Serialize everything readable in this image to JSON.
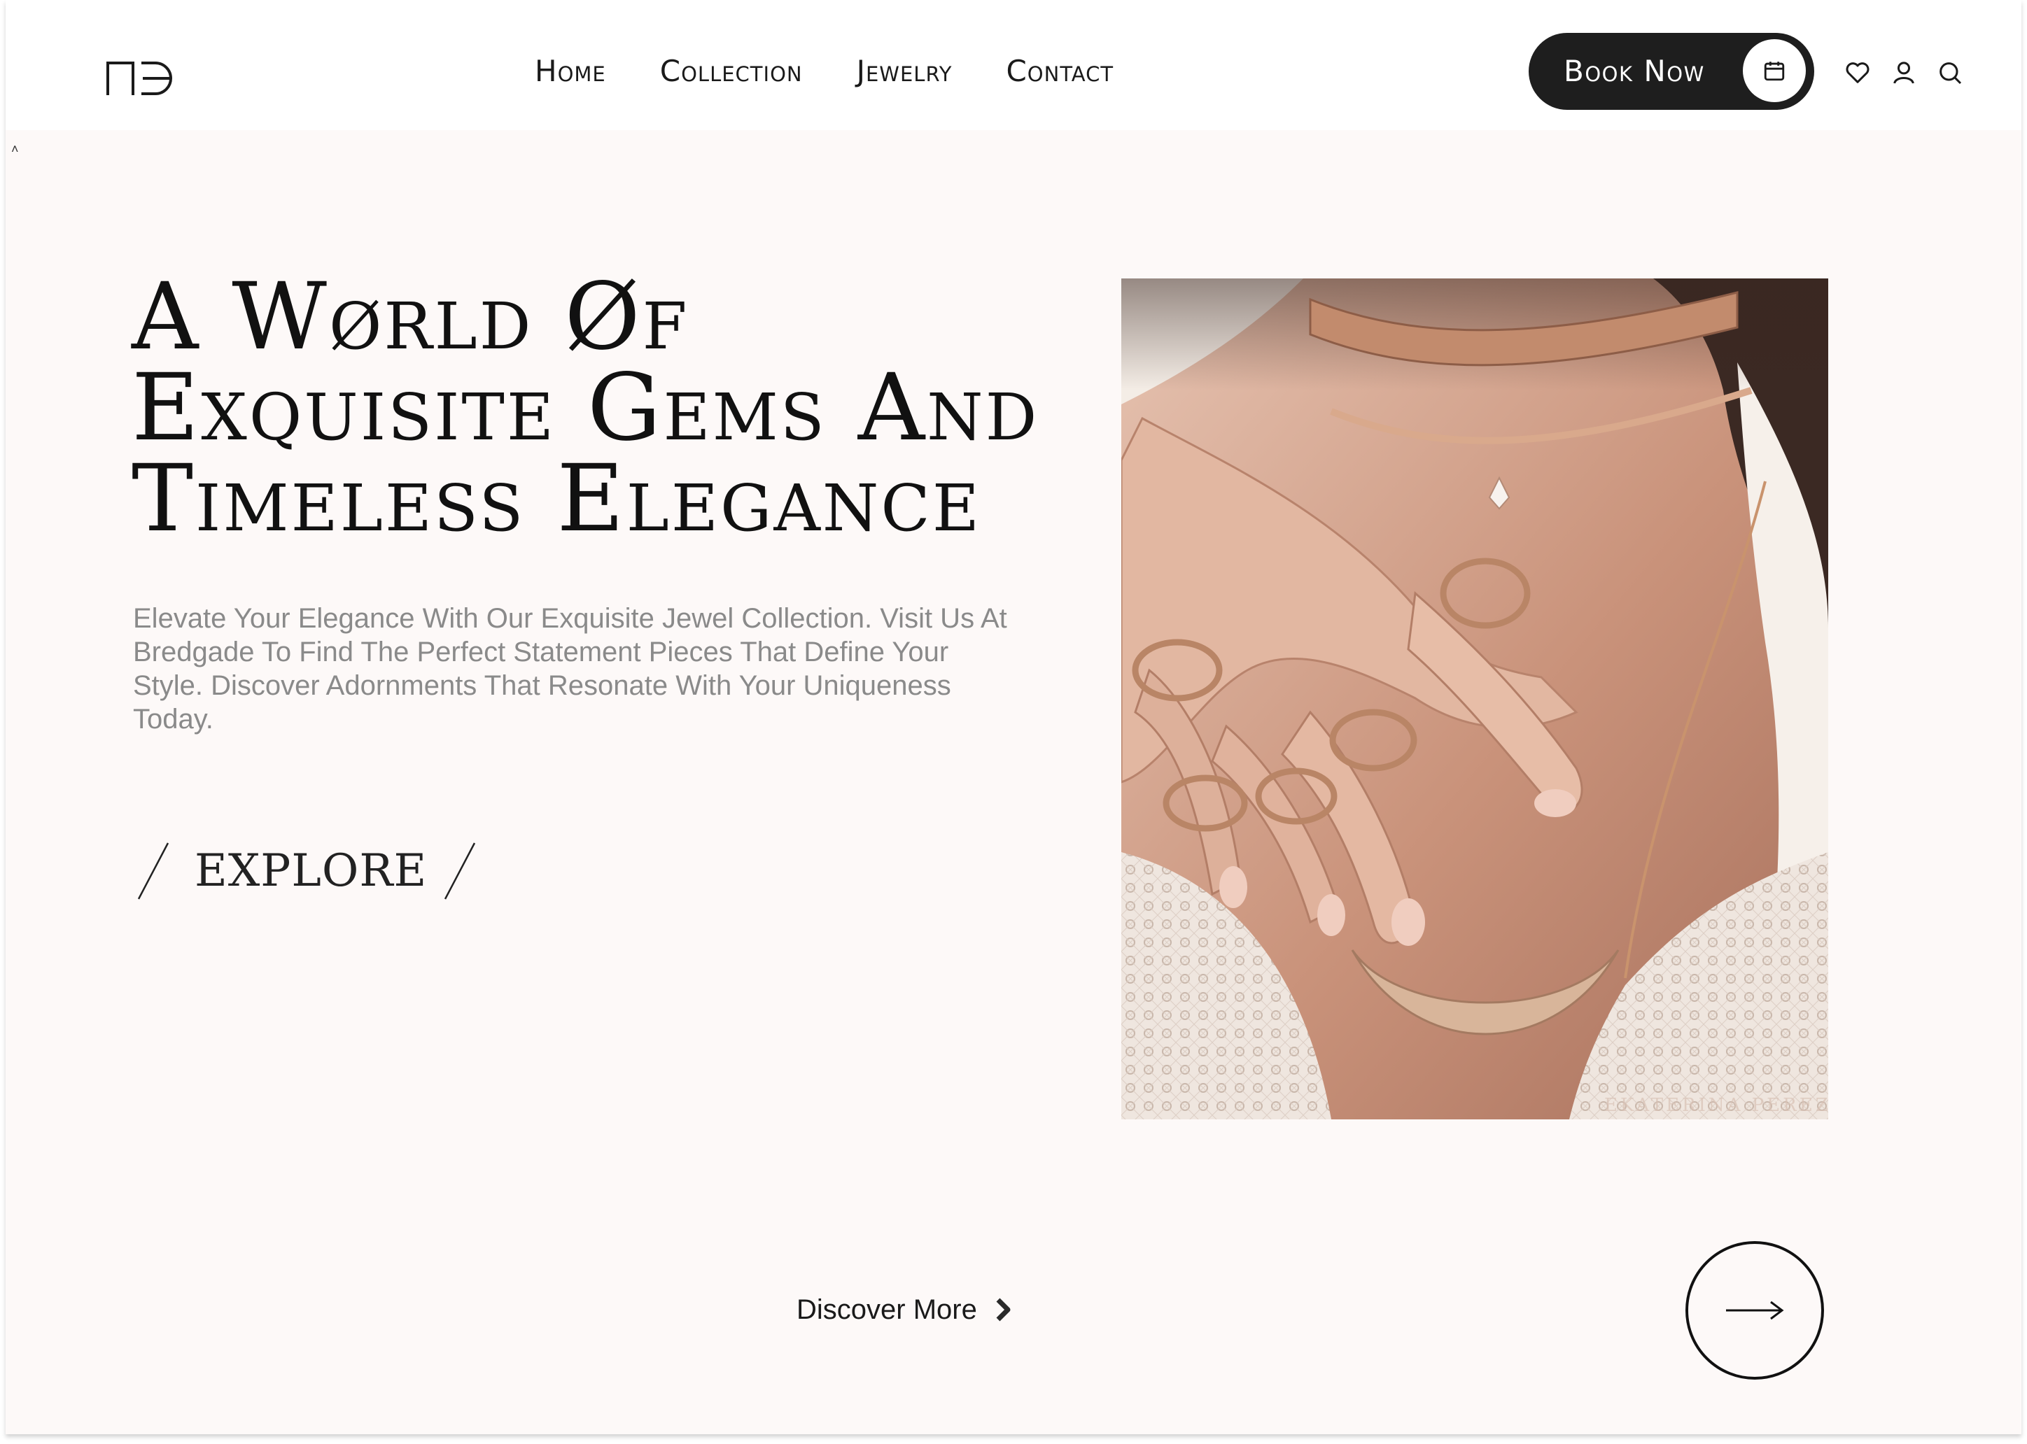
{
  "header": {
    "nav": [
      "Home",
      "Collection",
      "Jewelry",
      "Contact"
    ],
    "book_label": "Book Now"
  },
  "icons": {
    "logo": "brand-logo",
    "book": "calendar-icon",
    "wishlist": "heart-icon",
    "account": "user-icon",
    "search": "search-icon",
    "explore_next": "arrow-right-icon",
    "discover": "chevron-right-icon"
  },
  "hero": {
    "title": "A Wørld Øf Exquisite Gems And Timeless Elegance",
    "subtitle": "Elevate Your Elegance With Our Exquisite Jewel Collection. Visit Us At Bredgade To Find The Perfect Statement Pieces That Define Your Style. Discover Adornments That Resonate With Your Uniqueness Today.",
    "explore_label": "EXPLORE",
    "image_alt": "Model wearing rose gold rings, chokers and a pendant necklace"
  },
  "footer": {
    "discover_label": "Discover More"
  },
  "colors": {
    "background": "#fdf9f8",
    "header": "#ffffff",
    "button_dark": "#1e1e1e",
    "text": "#111111",
    "muted_text": "#8a8a8a"
  }
}
